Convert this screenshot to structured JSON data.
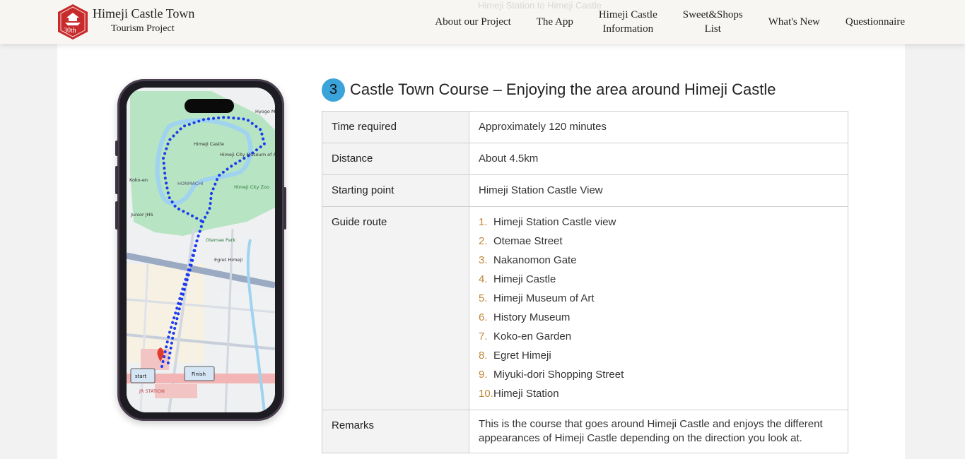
{
  "header": {
    "logo_line1": "Himeji Castle Town",
    "logo_line2": "Tourism Project",
    "badge_text": "30th",
    "faded_text": "Himeji Station to Himeji Castle",
    "nav": [
      {
        "line1": "About our Project",
        "line2": ""
      },
      {
        "line1": "The App",
        "line2": ""
      },
      {
        "line1": "Himeji Castle",
        "line2": "Information"
      },
      {
        "line1": "Sweet&Shops",
        "line2": "List"
      },
      {
        "line1": "What's New",
        "line2": ""
      },
      {
        "line1": "Questionnaire",
        "line2": ""
      }
    ]
  },
  "section": {
    "number": "3",
    "title": "Castle Town Course – Enjoying the area around Himeji Castle"
  },
  "table": {
    "time_label": "Time required",
    "time_value": "Approximately 120 minutes",
    "distance_label": "Distance",
    "distance_value": "About 4.5km",
    "start_label": "Starting point",
    "start_value": "Himeji Station Castle View",
    "route_label": "Guide route",
    "route": [
      {
        "num": "1.",
        "name": "Himeji Station Castle view"
      },
      {
        "num": "2.",
        "name": "Otemae Street"
      },
      {
        "num": "3.",
        "name": "Nakanomon Gate"
      },
      {
        "num": "4.",
        "name": "Himeji Castle"
      },
      {
        "num": "5.",
        "name": "Himeji Museum of Art"
      },
      {
        "num": "6.",
        "name": "History Museum"
      },
      {
        "num": "7.",
        "name": "Koko-en Garden"
      },
      {
        "num": "8.",
        "name": "Egret Himeji"
      },
      {
        "num": "9.",
        "name": "Miyuki-dori Shopping Street"
      },
      {
        "num": "10.",
        "name": "Himeji Station"
      }
    ],
    "remarks_label": "Remarks",
    "remarks_value": "This is the course that goes around Himeji Castle and enjoys the different appearances of Himeji Castle depending on the direction you look at."
  },
  "map": {
    "labels": {
      "hyogo_museum": "Hyogo Museu",
      "himeji_castle": "Himeji Castle",
      "himeji_city_museum": "Himeji City Museum of Art",
      "koko_en": "Koko-en",
      "honmachi": "HONMACHI",
      "zoo": "Himeji City Zoo",
      "jhs": "Junior JHS",
      "otemae_park": "Otemae Park",
      "egret": "Egret Himeji",
      "start": "start",
      "finish": "Finish",
      "station": "JR STATION"
    },
    "colors": {
      "route": "#1a3cf0",
      "park": "#b7e4c2",
      "water": "#9fd3ef",
      "road": "#9aaac2",
      "land": "#f6f1e2"
    }
  },
  "colors": {
    "accent": "#3aa3d9",
    "route_number": "#c0873a",
    "logo_red": "#c82b2b"
  }
}
